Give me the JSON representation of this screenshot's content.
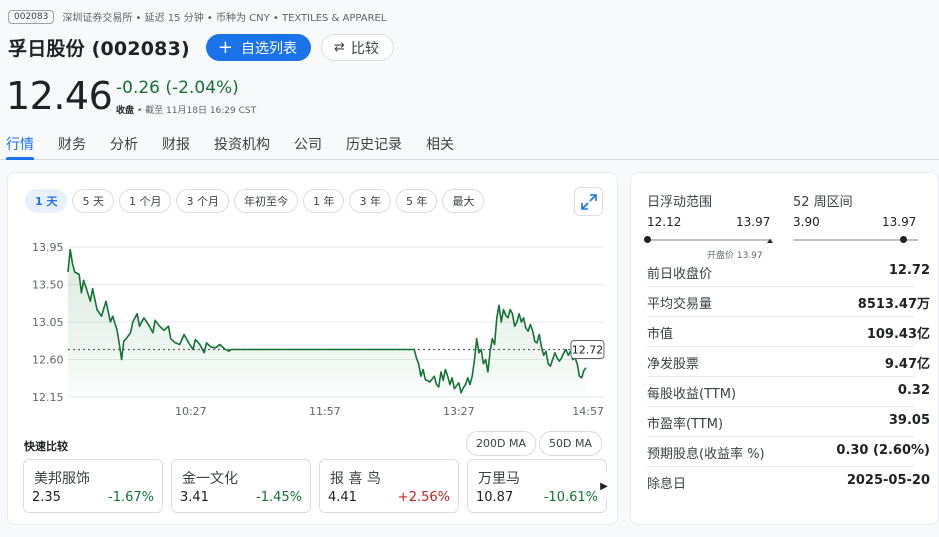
{
  "meta": {
    "ticker_chip": "002083",
    "exchange_line": "深圳证券交易所 • 延迟 15 分钟 • 币种为 CNY • TEXTILES & APPAREL"
  },
  "header": {
    "title": "孚日股份 (002083)",
    "follow_label": "自选列表",
    "compare_label": "比较"
  },
  "quote": {
    "price": "12.46",
    "change": "-0.26 (-2.04%)",
    "close_label": "收盘",
    "close_time": "截至 11月18日 16:29 CST"
  },
  "tabs": [
    "行情",
    "财务",
    "分析",
    "财报",
    "投资机构",
    "公司",
    "历史记录",
    "相关"
  ],
  "range_chips": [
    "1 天",
    "5 天",
    "1 个月",
    "3 个月",
    "年初至今",
    "1 年",
    "3 年",
    "5 年",
    "最大"
  ],
  "chart_data": {
    "type": "line",
    "title": "",
    "xlabel": "",
    "ylabel": "",
    "y_ticks": [
      "13.95",
      "13.50",
      "13.05",
      "12.60",
      "12.15"
    ],
    "x_ticks": [
      "10:27",
      "11:57",
      "13:27",
      "14:57"
    ],
    "ylim": [
      12.15,
      13.95
    ],
    "x_minutes": [
      0,
      240
    ],
    "previous_close": 12.72,
    "previous_close_label": "12.72",
    "grid": true,
    "series": [
      {
        "points": [
          [
            0,
            13.65
          ],
          [
            1,
            13.92
          ],
          [
            2,
            13.75
          ],
          [
            3,
            13.65
          ],
          [
            5,
            13.62
          ],
          [
            6,
            13.4
          ],
          [
            7,
            13.55
          ],
          [
            8,
            13.47
          ],
          [
            10,
            13.3
          ],
          [
            11,
            13.45
          ],
          [
            13,
            13.2
          ],
          [
            15,
            13.12
          ],
          [
            17,
            13.3
          ],
          [
            19,
            13.05
          ],
          [
            20,
            13.12
          ],
          [
            22,
            12.95
          ],
          [
            23,
            12.78
          ],
          [
            24,
            12.6
          ],
          [
            25,
            12.82
          ],
          [
            26,
            12.85
          ],
          [
            28,
            12.92
          ],
          [
            29,
            13.05
          ],
          [
            31,
            13.15
          ],
          [
            32,
            13.0
          ],
          [
            34,
            13.1
          ],
          [
            36,
            13.02
          ],
          [
            38,
            12.92
          ],
          [
            39,
            13.07
          ],
          [
            41,
            13.0
          ],
          [
            43,
            12.95
          ],
          [
            45,
            13.0
          ],
          [
            46,
            12.85
          ],
          [
            48,
            12.8
          ],
          [
            50,
            12.78
          ],
          [
            52,
            12.9
          ],
          [
            54,
            12.8
          ],
          [
            56,
            12.72
          ],
          [
            57,
            12.84
          ],
          [
            59,
            12.78
          ],
          [
            61,
            12.68
          ],
          [
            62,
            12.8
          ],
          [
            64,
            12.75
          ],
          [
            66,
            12.74
          ],
          [
            68,
            12.78
          ],
          [
            70,
            12.73
          ],
          [
            72,
            12.7
          ],
          [
            73,
            12.72
          ],
          [
            75,
            12.72
          ],
          [
            120,
            12.72
          ],
          [
            155,
            12.72
          ],
          [
            156,
            12.62
          ],
          [
            157,
            12.55
          ],
          [
            158,
            12.4
          ],
          [
            159,
            12.48
          ],
          [
            160,
            12.36
          ],
          [
            162,
            12.33
          ],
          [
            164,
            12.4
          ],
          [
            165,
            12.3
          ],
          [
            166,
            12.27
          ],
          [
            167,
            12.45
          ],
          [
            168,
            12.35
          ],
          [
            169,
            12.48
          ],
          [
            170,
            12.4
          ],
          [
            171,
            12.3
          ],
          [
            172,
            12.38
          ],
          [
            173,
            12.25
          ],
          [
            175,
            12.32
          ],
          [
            176,
            12.2
          ],
          [
            177,
            12.26
          ],
          [
            178,
            12.3
          ],
          [
            179,
            12.38
          ],
          [
            180,
            12.3
          ],
          [
            181,
            12.4
          ],
          [
            182,
            12.6
          ],
          [
            183,
            12.85
          ],
          [
            184,
            12.68
          ],
          [
            185,
            12.72
          ],
          [
            186,
            12.55
          ],
          [
            187,
            12.6
          ],
          [
            188,
            12.45
          ],
          [
            189,
            12.7
          ],
          [
            190,
            12.85
          ],
          [
            191,
            12.78
          ],
          [
            192,
            13.1
          ],
          [
            193,
            13.25
          ],
          [
            194,
            13.05
          ],
          [
            195,
            13.2
          ],
          [
            196,
            13.13
          ],
          [
            197,
            13.1
          ],
          [
            198,
            13.2
          ],
          [
            199,
            13.15
          ],
          [
            200,
            13.0
          ],
          [
            201,
            13.05
          ],
          [
            202,
            13.15
          ],
          [
            203,
            13.05
          ],
          [
            204,
            13.1
          ],
          [
            205,
            12.98
          ],
          [
            206,
            12.94
          ],
          [
            207,
            13.02
          ],
          [
            208,
            12.95
          ],
          [
            209,
            12.82
          ],
          [
            210,
            12.8
          ],
          [
            211,
            12.9
          ],
          [
            212,
            12.75
          ],
          [
            213,
            12.65
          ],
          [
            214,
            12.7
          ],
          [
            215,
            12.55
          ],
          [
            216,
            12.52
          ],
          [
            217,
            12.6
          ],
          [
            218,
            12.68
          ],
          [
            219,
            12.62
          ],
          [
            220,
            12.58
          ],
          [
            221,
            12.62
          ],
          [
            222,
            12.68
          ],
          [
            223,
            12.72
          ],
          [
            224,
            12.65
          ],
          [
            225,
            12.7
          ],
          [
            226,
            12.6
          ],
          [
            227,
            12.62
          ],
          [
            228,
            12.55
          ],
          [
            229,
            12.4
          ],
          [
            230,
            12.38
          ],
          [
            231,
            12.47
          ],
          [
            232,
            12.5
          ]
        ]
      }
    ]
  },
  "quick_compare": {
    "title": "快速比较",
    "ma_buttons": [
      "200D MA",
      "50D MA"
    ],
    "items": [
      {
        "name": "美邦服饰",
        "price": "2.35",
        "change": "-1.67%",
        "color": "#137333"
      },
      {
        "name": "金一文化",
        "price": "3.41",
        "change": "-1.45%",
        "color": "#137333"
      },
      {
        "name": "报 喜 鸟",
        "price": "4.41",
        "change": "+2.56%",
        "color": "#c5221f"
      },
      {
        "name": "万里马",
        "price": "10.87",
        "change": "-10.61%",
        "color": "#137333"
      }
    ]
  },
  "ranges": {
    "day_label": "日浮动范围",
    "day_low": "12.12",
    "day_high": "13.97",
    "open_label": "开盘价 13.97",
    "week52_label": "52 周区间",
    "week52_low": "3.90",
    "week52_high": "13.97"
  },
  "stats": [
    {
      "key": "前日收盘价",
      "value": "12.72"
    },
    {
      "key": "平均交易量",
      "value": "8513.47万"
    },
    {
      "key": "市值",
      "value": "109.43亿"
    },
    {
      "key": "净发股票",
      "value": "9.47亿"
    },
    {
      "key": "每股收益(TTM)",
      "value": "0.32"
    },
    {
      "key": "市盈率(TTM)",
      "value": "39.05"
    },
    {
      "key": "预期股息(收益率 %)",
      "value": "0.30 (2.60%)"
    },
    {
      "key": "除息日",
      "value": "2025-05-20"
    }
  ],
  "colors": {
    "accent": "#1a73e8",
    "down": "#137333",
    "up": "#c5221f"
  }
}
